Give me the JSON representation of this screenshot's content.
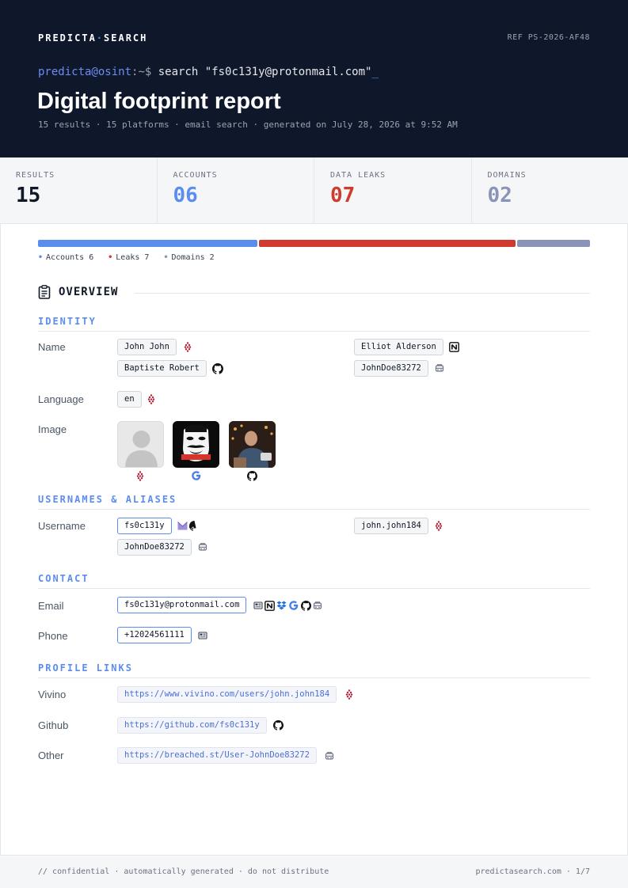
{
  "header": {
    "brand_left": "PREDICTA",
    "brand_sep": "·",
    "brand_right": "SEARCH",
    "ref": "REF PS-2026-AF48",
    "cmd_user": "predicta@osint",
    "cmd_path": ":~$",
    "cmd_text": " search \"fs0c131y@protonmail.com\"",
    "cmd_cursor": "_",
    "title": "Digital footprint report",
    "subtitle": "15 results · 15 platforms · email search · generated on July 28, 2026 at 9:52 AM"
  },
  "stats": [
    {
      "label": "RESULTS",
      "value": "15",
      "color": "#111827"
    },
    {
      "label": "ACCOUNTS",
      "value": "06",
      "color": "#5b8def"
    },
    {
      "label": "DATA LEAKS",
      "value": "07",
      "color": "#d13b2f"
    },
    {
      "label": "DOMAINS",
      "value": "02",
      "color": "#8a94b8"
    }
  ],
  "distribution": {
    "accounts": 6,
    "leaks": 7,
    "domains": 2,
    "colors": {
      "accounts": "#5b8def",
      "leaks": "#d13b2f",
      "domains": "#8a94b8"
    },
    "legend": [
      {
        "bullet": "•",
        "text": "Accounts 6"
      },
      {
        "bullet": "•",
        "text": "Leaks 7"
      },
      {
        "bullet": "•",
        "text": "Domains 2"
      }
    ]
  },
  "overview": {
    "title": "OVERVIEW",
    "identity": {
      "heading": "IDENTITY",
      "name_label": "Name",
      "names": [
        "John John",
        "Elliot Alderson",
        "Baptiste Robert",
        "JohnDoe83272"
      ],
      "language_label": "Language",
      "language": "en",
      "image_label": "Image",
      "images": [
        "default-avatar",
        "fsociety-mask",
        "person-photo"
      ]
    },
    "usernames": {
      "heading": "USERNAMES & ALIASES",
      "label": "Username",
      "values": [
        "fs0c131y",
        "john.john184",
        "JohnDoe83272"
      ]
    },
    "contact": {
      "heading": "CONTACT",
      "email_label": "Email",
      "email": "fs0c131y@protonmail.com",
      "phone_label": "Phone",
      "phone": "+12024561111"
    },
    "links": {
      "heading": "PROFILE LINKS",
      "items": [
        {
          "label": "Vivino",
          "url": "https://www.vivino.com/users/john.john184"
        },
        {
          "label": "Github",
          "url": "https://github.com/fs0c131y"
        },
        {
          "label": "Other",
          "url": "https://breached.st/User-JohnDoe83272"
        }
      ]
    }
  },
  "footer": {
    "left": "// confidential · automatically generated · do not distribute",
    "right": "predictasearch.com · 1/7"
  }
}
